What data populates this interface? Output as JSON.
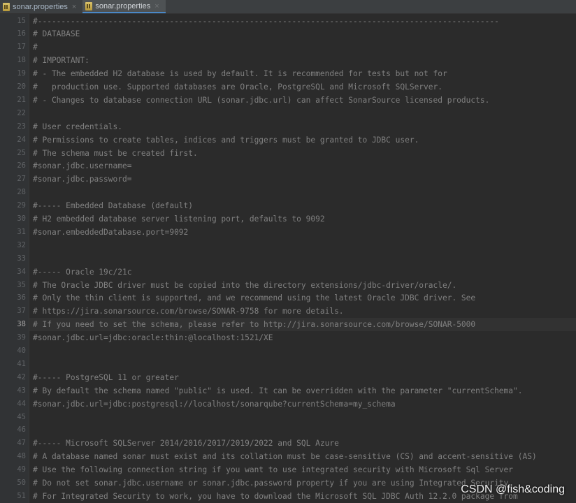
{
  "tabs": [
    {
      "label": "sonar.properties",
      "close": "×",
      "active": false
    },
    {
      "label": "sonar.properties",
      "close": "×",
      "active": true
    }
  ],
  "current_line_number": "38",
  "lines": [
    {
      "n": "15",
      "text": "#--------------------------------------------------------------------------------------------------"
    },
    {
      "n": "16",
      "text": "# DATABASE"
    },
    {
      "n": "17",
      "text": "#"
    },
    {
      "n": "18",
      "text": "# IMPORTANT:"
    },
    {
      "n": "19",
      "text": "# - The embedded H2 database is used by default. It is recommended for tests but not for"
    },
    {
      "n": "20",
      "text": "#   production use. Supported databases are Oracle, PostgreSQL and Microsoft SQLServer."
    },
    {
      "n": "21",
      "text": "# - Changes to database connection URL (sonar.jdbc.url) can affect SonarSource licensed products."
    },
    {
      "n": "22",
      "text": ""
    },
    {
      "n": "23",
      "text": "# User credentials."
    },
    {
      "n": "24",
      "text": "# Permissions to create tables, indices and triggers must be granted to JDBC user."
    },
    {
      "n": "25",
      "text": "# The schema must be created first."
    },
    {
      "n": "26",
      "text": "#sonar.jdbc.username="
    },
    {
      "n": "27",
      "text": "#sonar.jdbc.password="
    },
    {
      "n": "28",
      "text": ""
    },
    {
      "n": "29",
      "text": "#----- Embedded Database (default)"
    },
    {
      "n": "30",
      "text": "# H2 embedded database server listening port, defaults to 9092"
    },
    {
      "n": "31",
      "text": "#sonar.embeddedDatabase.port=9092"
    },
    {
      "n": "32",
      "text": ""
    },
    {
      "n": "33",
      "text": ""
    },
    {
      "n": "34",
      "text": "#----- Oracle 19c/21c"
    },
    {
      "n": "35",
      "text": "# The Oracle JDBC driver must be copied into the directory extensions/jdbc-driver/oracle/."
    },
    {
      "n": "36",
      "text": "# Only the thin client is supported, and we recommend using the latest Oracle JDBC driver. See"
    },
    {
      "n": "37",
      "text": "# https://jira.sonarsource.com/browse/SONAR-9758 for more details."
    },
    {
      "n": "38",
      "text": "# If you need to set the schema, please refer to http://jira.sonarsource.com/browse/SONAR-5000"
    },
    {
      "n": "39",
      "text": "#sonar.jdbc.url=jdbc:oracle:thin:@localhost:1521/XE"
    },
    {
      "n": "40",
      "text": ""
    },
    {
      "n": "41",
      "text": ""
    },
    {
      "n": "42",
      "text": "#----- PostgreSQL 11 or greater"
    },
    {
      "n": "43",
      "text": "# By default the schema named \"public\" is used. It can be overridden with the parameter \"currentSchema\"."
    },
    {
      "n": "44",
      "text": "#sonar.jdbc.url=jdbc:postgresql://localhost/sonarqube?currentSchema=my_schema"
    },
    {
      "n": "45",
      "text": ""
    },
    {
      "n": "46",
      "text": ""
    },
    {
      "n": "47",
      "text": "#----- Microsoft SQLServer 2014/2016/2017/2019/2022 and SQL Azure"
    },
    {
      "n": "48",
      "text": "# A database named sonar must exist and its collation must be case-sensitive (CS) and accent-sensitive (AS)"
    },
    {
      "n": "49",
      "text": "# Use the following connection string if you want to use integrated security with Microsoft Sql Server"
    },
    {
      "n": "50",
      "text": "# Do not set sonar.jdbc.username or sonar.jdbc.password property if you are using Integrated Security"
    },
    {
      "n": "51",
      "text": "# For Integrated Security to work, you have to download the Microsoft SQL JDBC Auth 12.2.0 package from"
    }
  ],
  "watermark": "CSDN @fish&coding"
}
